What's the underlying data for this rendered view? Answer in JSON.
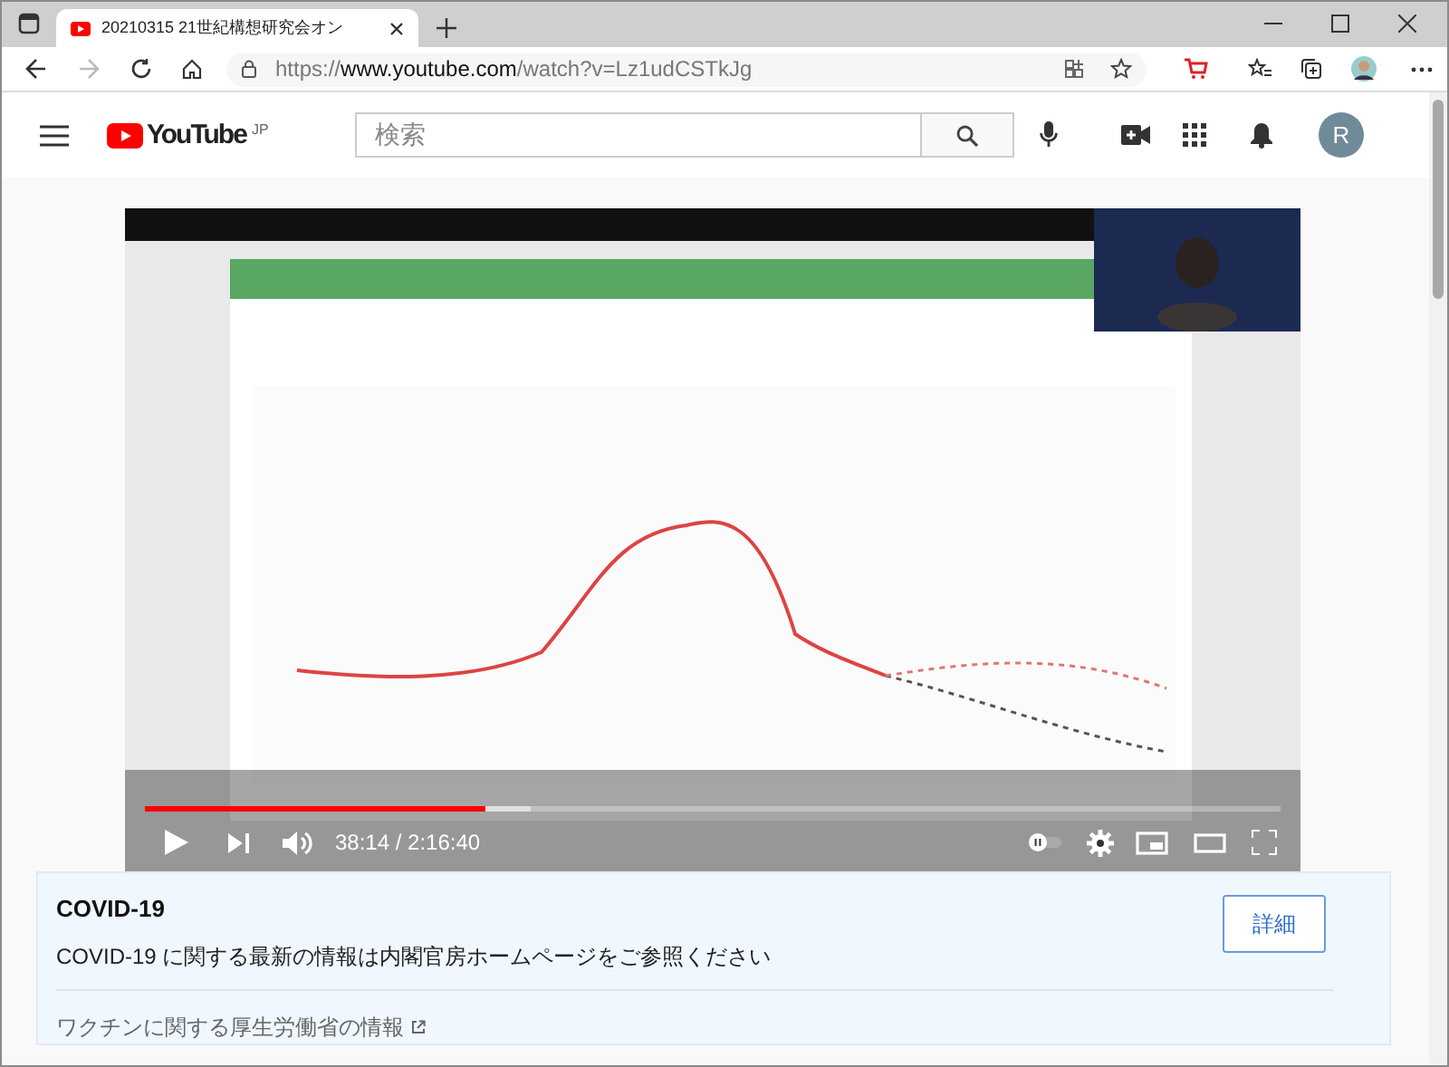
{
  "browser": {
    "tab_title": "20210315 21世紀構想研究会オン",
    "url_prefix": "https://",
    "url_host": "www.youtube.com",
    "url_path": "/watch?v=Lz1udCSTkJg"
  },
  "header": {
    "logo_text": "YouTube",
    "logo_region": "JP",
    "search_placeholder": "検索",
    "avatar_letter": "R"
  },
  "player": {
    "progress": {
      "level": 0.3
    },
    "buffered": {
      "level": 0.34
    },
    "time": "38:14 / 2:16:40"
  },
  "info_panel": {
    "title": "COVID-19",
    "message": "COVID-19 に関する最新の情報は内閣官房ホームページをご参照ください",
    "button": "詳細",
    "link": "ワクチンに関する厚生労働省の情報"
  }
}
